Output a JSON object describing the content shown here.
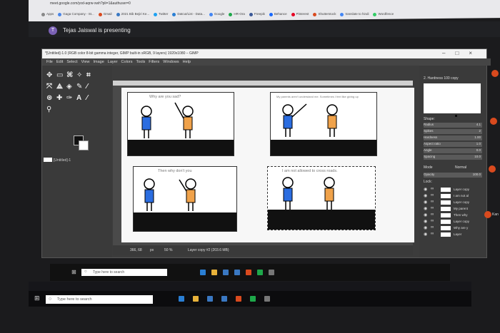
{
  "browser": {
    "url": "meet.google.com/yod-aqrw-xwh?pli=1&authuser=0",
    "bookmarks": [
      "Apps",
      "Gaga Company - St...",
      "Gmail",
      "2021 Bib Bejiri Ke...",
      "Twitter",
      "Datcut/List - Data...",
      "Google",
      "HR-Ora",
      "Freepik",
      "Behance",
      "Pinterest",
      "Shutterstock",
      "translate to hindi",
      "Wordfence"
    ]
  },
  "meet": {
    "presenter_initial": "T",
    "presenter_text": "Tejas Jaiswal is presenting",
    "side_name": "Kan"
  },
  "gimp": {
    "title": "*[Untitled]-1.0 (RGB color 8-bit gamma integer, GIMP built-in sRGB, 9 layers) 1920x1080 – GIMP",
    "window_controls": [
      "–",
      "□",
      "×"
    ],
    "menus": [
      "File",
      "Edit",
      "Select",
      "View",
      "Image",
      "Layer",
      "Colors",
      "Tools",
      "Filters",
      "Windows",
      "Help"
    ],
    "image_list_label": "[Untitled]-1",
    "brush_label": "2. Hardness 100 copy",
    "tool_options": [
      {
        "label": "Radius",
        "value": "4.1"
      },
      {
        "label": "Spikes",
        "value": "2"
      },
      {
        "label": "Hardness",
        "value": "1.00"
      },
      {
        "label": "Aspect ratio",
        "value": "1.0"
      },
      {
        "label": "Angle",
        "value": "0.0"
      },
      {
        "label": "Spacing",
        "value": "10.0"
      }
    ],
    "shape_label": "Shape:",
    "mode_label": "Mode",
    "mode_value": "Normal",
    "opacity_label": "Opacity",
    "opacity_value": "100.0",
    "lock_label": "Lock:",
    "layers": [
      "Layer copy",
      "I am not al",
      "Layer copy",
      "My parent",
      "Then why",
      "Layer copy",
      "Why are y",
      "Layer"
    ],
    "status": {
      "coords": "366, 68",
      "units": "px",
      "zoom": "50 %",
      "layer": "Layer copy #2 (203.6 MB)"
    }
  },
  "comic": {
    "panel1_text": "Why are you sad?",
    "panel2_text": "My parents aren't understand me. Sometimes I feel like giving up",
    "panel3_text": "Then why don't you",
    "panel4_text": "I am not allowed to cross roads."
  },
  "taskbar": {
    "search_placeholder": "Type here to search"
  },
  "colors": {
    "blue_figure": "#2b6de0",
    "orange_figure": "#f0a24a",
    "accent_red": "#d94a1e"
  }
}
